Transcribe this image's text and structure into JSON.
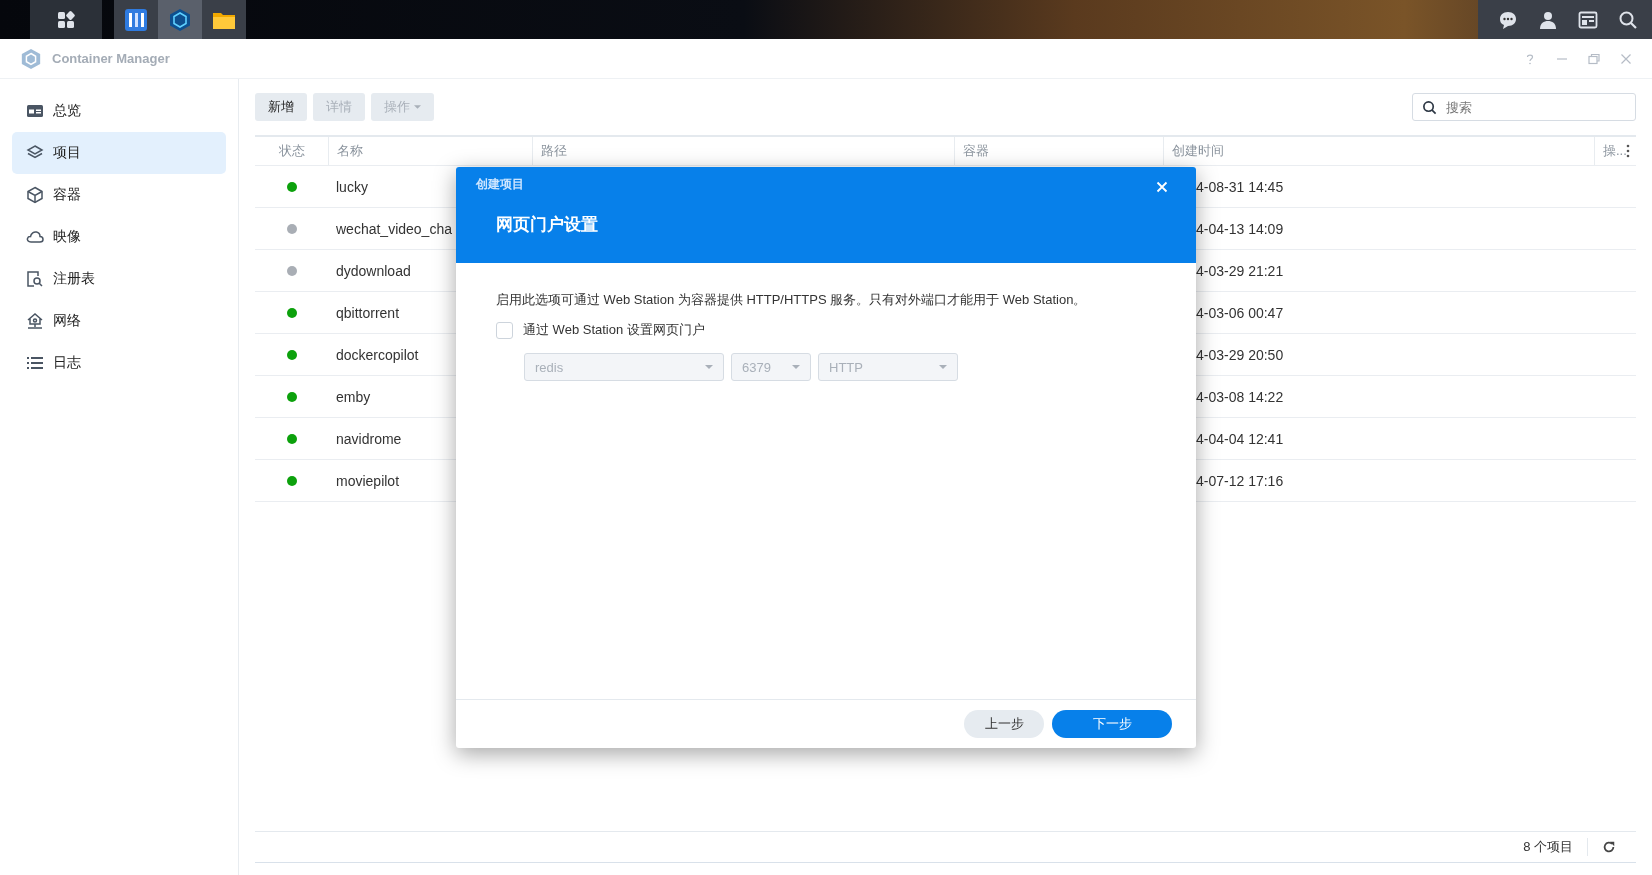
{
  "window": {
    "title": "Container Manager"
  },
  "sidebar": {
    "items": [
      {
        "label": "总览",
        "selected": false
      },
      {
        "label": "项目",
        "selected": true
      },
      {
        "label": "容器",
        "selected": false
      },
      {
        "label": "映像",
        "selected": false
      },
      {
        "label": "注册表",
        "selected": false
      },
      {
        "label": "网络",
        "selected": false
      },
      {
        "label": "日志",
        "selected": false
      }
    ]
  },
  "toolbar": {
    "buttons": [
      {
        "label": "新增",
        "disabled": false,
        "dropdown": false
      },
      {
        "label": "详情",
        "disabled": true,
        "dropdown": false
      },
      {
        "label": "操作",
        "disabled": true,
        "dropdown": true
      }
    ],
    "search": {
      "placeholder": "搜索"
    }
  },
  "table": {
    "columns": [
      "状态",
      "名称",
      "路径",
      "容器",
      "创建时间",
      "操..."
    ],
    "rows": [
      {
        "color": "#0ca10c",
        "name": "lucky",
        "created": "4-08-31 14:45"
      },
      {
        "color": "#a9aeb5",
        "name": "wechat_video_cha",
        "created": "4-04-13 14:09"
      },
      {
        "color": "#a9aeb5",
        "name": "dydownload",
        "created": "4-03-29 21:21"
      },
      {
        "color": "#0ca10c",
        "name": "qbittorrent",
        "created": "4-03-06 00:47"
      },
      {
        "color": "#0ca10c",
        "name": "dockercopilot",
        "created": "4-03-29 20:50"
      },
      {
        "color": "#0ca10c",
        "name": "emby",
        "created": "4-03-08 14:22"
      },
      {
        "color": "#0ca10c",
        "name": "navidrome",
        "created": "4-04-04 12:41"
      },
      {
        "color": "#0ca10c",
        "name": "moviepilot",
        "created": "4-07-12 17:16"
      }
    ]
  },
  "status_bar": {
    "count": "8 个项目"
  },
  "dialog": {
    "caption": "创建项目",
    "title": "网页门户设置",
    "description": "启用此选项可通过 Web Station 为容器提供 HTTP/HTTPS 服务。只有对外端口才能用于 Web Station。",
    "checkbox": {
      "label": "通过 Web Station 设置网页门户",
      "checked": false
    },
    "selects": [
      {
        "value": "redis",
        "disabled": true
      },
      {
        "value": "6379",
        "disabled": true
      },
      {
        "value": "HTTP",
        "disabled": true
      }
    ],
    "buttons": [
      {
        "label": "上一步",
        "kind": "secondary"
      },
      {
        "label": "下一步",
        "kind": "primary"
      }
    ]
  }
}
